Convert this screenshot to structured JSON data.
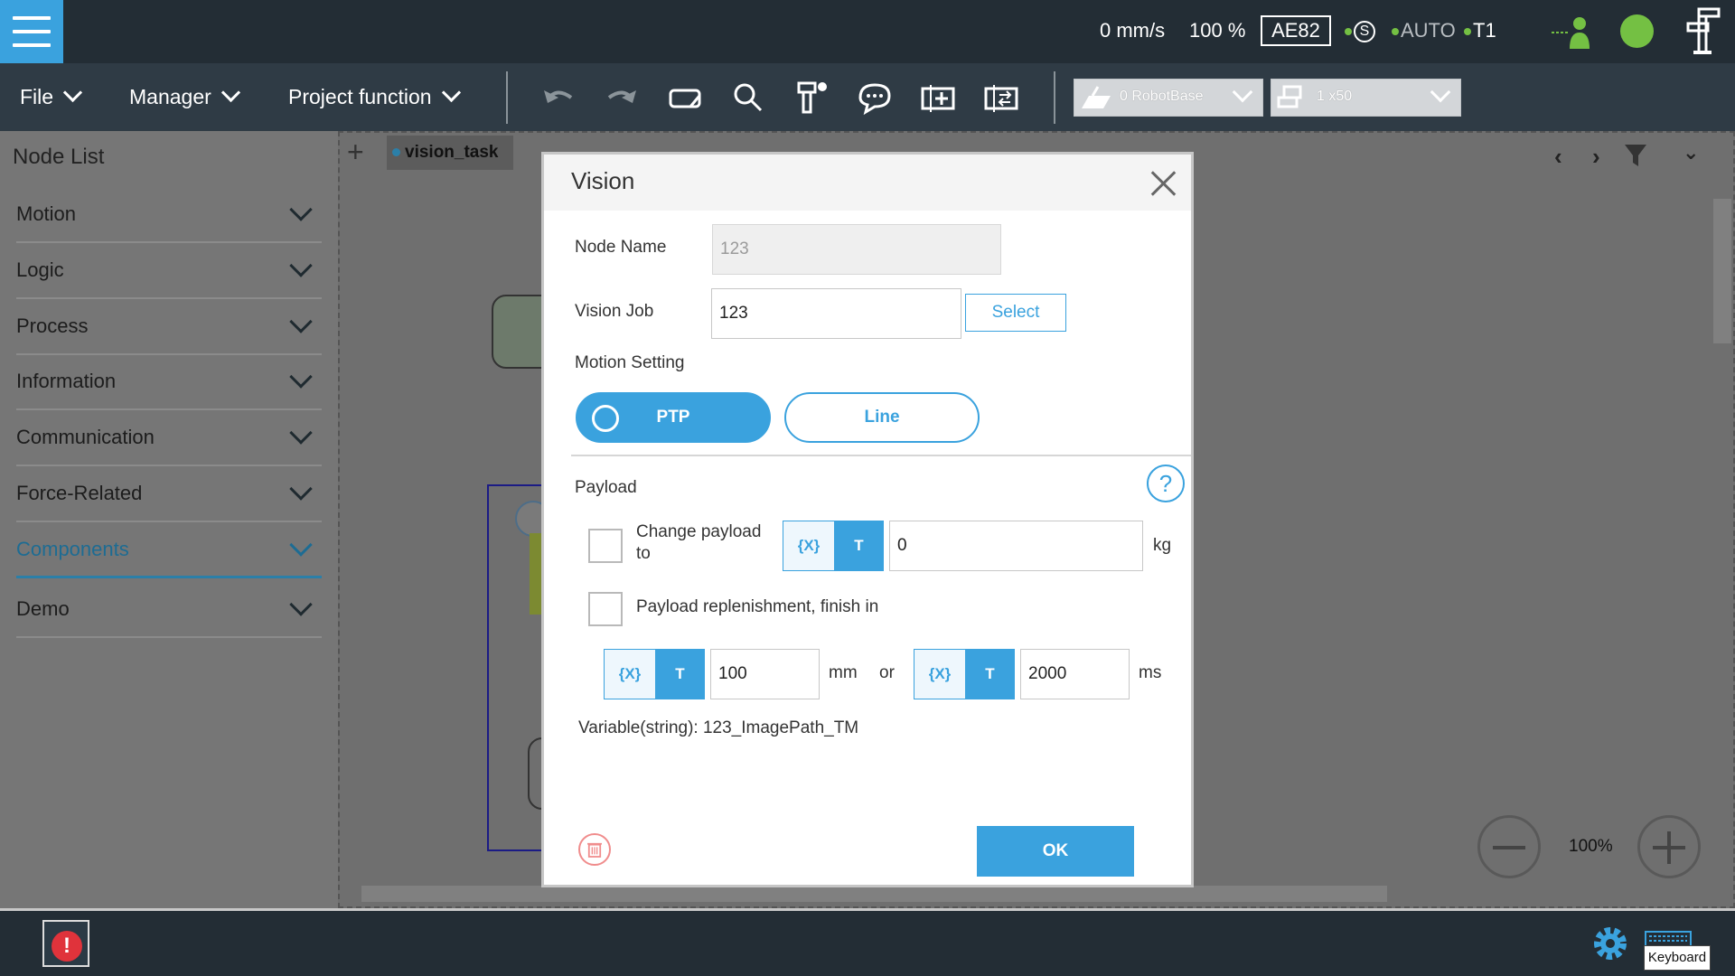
{
  "status": {
    "speed": "0 mm/s",
    "speed_percent": "100 %",
    "robot_id": "AE82",
    "safety_label": "S",
    "mode": "AUTO",
    "operation_mode": "T1"
  },
  "toolbar": {
    "file": "File",
    "manager": "Manager",
    "project_function": "Project function",
    "base_combo": "0 RobotBase",
    "tool_combo": "1 x50"
  },
  "node_list": {
    "title": "Node List",
    "categories": [
      {
        "label": "Motion"
      },
      {
        "label": "Logic"
      },
      {
        "label": "Process"
      },
      {
        "label": "Information"
      },
      {
        "label": "Communication"
      },
      {
        "label": "Force-Related"
      },
      {
        "label": "Components"
      },
      {
        "label": "Demo"
      }
    ]
  },
  "canvas": {
    "tab_label": "vision_task",
    "zoom_level": "100%"
  },
  "dialog": {
    "title": "Vision",
    "node_name_label": "Node Name",
    "node_name_value": "123",
    "vision_job_label": "Vision Job",
    "vision_job_value": "123",
    "select_button": "Select",
    "motion_setting_label": "Motion Setting",
    "motion_ptp": "PTP",
    "motion_line": "Line",
    "payload_label": "Payload",
    "help": "?",
    "change_payload_label": "Change payload to",
    "var_toggle": "{X}",
    "text_toggle": "T",
    "payload_value": "0",
    "payload_unit": "kg",
    "replenishment_label": "Payload replenishment, finish in",
    "distance_value": "100",
    "distance_unit": "mm",
    "or_label": "or",
    "time_value": "2000",
    "time_unit": "ms",
    "variable_text": "Variable(string): 123_ImagePath_TM",
    "ok_button": "OK"
  },
  "bottom": {
    "error_icon": "!",
    "keyboard_tooltip": "Keyboard"
  },
  "colors": {
    "accent": "#3aa2de",
    "topbar": "#232d35",
    "toolbar": "#2f3b45",
    "status_green": "#74c043",
    "error_red": "#e0333b"
  }
}
